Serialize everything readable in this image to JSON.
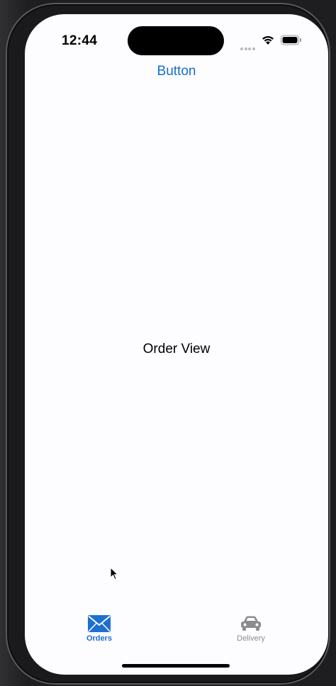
{
  "status_bar": {
    "time": "12:44",
    "icons": [
      "cellular-dots-icon",
      "wifi-icon",
      "battery-icon"
    ]
  },
  "nav": {
    "button_label": "Button"
  },
  "content": {
    "center_text": "Order View"
  },
  "tab_bar": {
    "tabs": [
      {
        "label": "Orders",
        "icon": "envelope-icon",
        "selected": true
      },
      {
        "label": "Delivery",
        "icon": "car-icon",
        "selected": false
      }
    ]
  },
  "colors": {
    "accent": "#1470c8",
    "tab_selected": "#1d6fd3",
    "tab_unselected": "#8c8c90",
    "background": "#fdfcfe"
  }
}
